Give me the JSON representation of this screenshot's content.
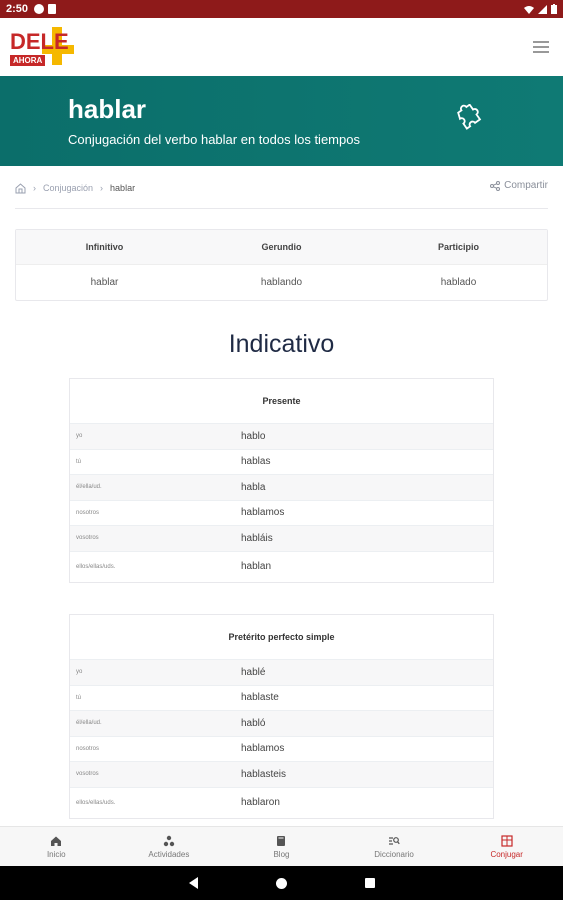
{
  "status": {
    "time": "2:50"
  },
  "logo": {
    "word": "DELE",
    "sub": "AHORA"
  },
  "hero": {
    "title": "hablar",
    "subtitle": "Conjugación del verbo hablar en todos los tiempos"
  },
  "breadcrumb": {
    "items": [
      "Conjugación",
      "hablar"
    ]
  },
  "share": {
    "label": "Compartir"
  },
  "forms": {
    "headers": [
      "Infinitivo",
      "Gerundio",
      "Participio"
    ],
    "values": [
      "hablar",
      "hablando",
      "hablado"
    ]
  },
  "section": {
    "title": "Indicativo"
  },
  "tenses": [
    {
      "name": "Presente",
      "rows": [
        {
          "pronoun": "yo",
          "form": "hablo"
        },
        {
          "pronoun": "tú",
          "form": "hablas"
        },
        {
          "pronoun": "él/ella/ud.",
          "form": "habla"
        },
        {
          "pronoun": "nosotros",
          "form": "hablamos"
        },
        {
          "pronoun": "vosotros",
          "form": "habláis"
        },
        {
          "pronoun": "ellos/ellas/uds.",
          "form": "hablan"
        }
      ]
    },
    {
      "name": "Pretérito perfecto simple",
      "rows": [
        {
          "pronoun": "yo",
          "form": "hablé"
        },
        {
          "pronoun": "tú",
          "form": "hablaste"
        },
        {
          "pronoun": "él/ella/ud.",
          "form": "habló"
        },
        {
          "pronoun": "nosotros",
          "form": "hablamos"
        },
        {
          "pronoun": "vosotros",
          "form": "hablasteis"
        },
        {
          "pronoun": "ellos/ellas/uds.",
          "form": "hablaron"
        }
      ]
    }
  ],
  "nav": {
    "items": [
      {
        "label": "Inicio",
        "icon": "home-icon"
      },
      {
        "label": "Actividades",
        "icon": "activities-icon"
      },
      {
        "label": "Blog",
        "icon": "book-icon"
      },
      {
        "label": "Diccionario",
        "icon": "dictionary-icon"
      },
      {
        "label": "Conjugar",
        "icon": "conjugate-icon"
      }
    ],
    "active_index": 4,
    "active_color": "#c62828"
  },
  "colors": {
    "status_bar": "#8e1a1a",
    "banner": "#0b6e6a",
    "brand_red": "#c62828",
    "brand_yellow": "#f5b800"
  }
}
